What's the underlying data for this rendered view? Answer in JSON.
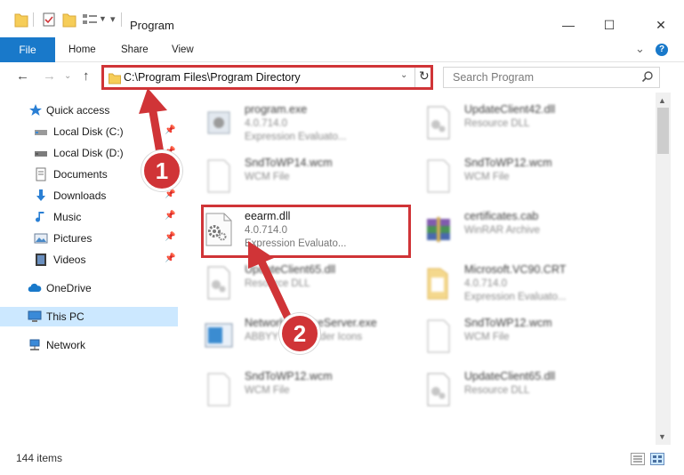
{
  "window": {
    "title": "Program",
    "controls": {
      "minimize": "—",
      "maximize": "☐",
      "close": "✕"
    }
  },
  "ribbon": {
    "tabs": [
      {
        "label": "File"
      },
      {
        "label": "Home"
      },
      {
        "label": "Share"
      },
      {
        "label": "View"
      }
    ],
    "expand_glyph": "⌄",
    "help_glyph": "?"
  },
  "nav": {
    "back": "←",
    "forward": "→",
    "history": "⌄",
    "up": "↑"
  },
  "address": {
    "path": "C:\\Program Files\\Program Directory",
    "dropdown": "⌄",
    "refresh": "↻"
  },
  "search": {
    "placeholder": "Search Program"
  },
  "sidebar": {
    "items": [
      {
        "label": "Quick access",
        "icon": "star-icon"
      },
      {
        "label": "Local Disk (C:)",
        "icon": "drive-icon",
        "pinned": true
      },
      {
        "label": "Local Disk (D:)",
        "icon": "drive-icon",
        "pinned": true
      },
      {
        "label": "Documents",
        "icon": "documents-icon",
        "pinned": true
      },
      {
        "label": "Downloads",
        "icon": "download-icon",
        "pinned": true
      },
      {
        "label": "Music",
        "icon": "music-icon",
        "pinned": true
      },
      {
        "label": "Pictures",
        "icon": "pictures-icon",
        "pinned": true
      },
      {
        "label": "Videos",
        "icon": "videos-icon",
        "pinned": true
      },
      {
        "label": "OneDrive",
        "icon": "cloud-icon"
      },
      {
        "label": "This PC",
        "icon": "computer-icon",
        "selected": true
      },
      {
        "label": "Network",
        "icon": "network-icon"
      }
    ],
    "pin_glyph": "📌"
  },
  "files": [
    {
      "name": "program.exe",
      "line1": "4.0.714.0",
      "line2": "Expression Evaluato...",
      "icon": "exe-icon"
    },
    {
      "name": "UpdateClient42.dll",
      "line1": "Resource DLL",
      "line2": "",
      "icon": "dll-icon"
    },
    {
      "name": "SndToWP14.wcm",
      "line1": "WCM File",
      "line2": "",
      "icon": "blank-file-icon"
    },
    {
      "name": "SndToWP12.wcm",
      "line1": "WCM File",
      "line2": "",
      "icon": "blank-file-icon"
    },
    {
      "name": "eearm.dll",
      "line1": "4.0.714.0",
      "line2": "Expression Evaluato...",
      "icon": "dll-gear-icon"
    },
    {
      "name": "certificates.cab",
      "line1": "WinRAR Archive",
      "line2": "",
      "icon": "winrar-icon"
    },
    {
      "name": "UpdateClient65.dll",
      "line1": "Resource DLL",
      "line2": "",
      "icon": "dll-icon"
    },
    {
      "name": "Microsoft.VC90.CRT",
      "line1": "4.0.714.0",
      "line2": "Expression Evaluato...",
      "icon": "folder-icon"
    },
    {
      "name": "NetworkLicenseServer.exe",
      "line1": "ABBYY FineReader Icons",
      "line2": "",
      "icon": "app-window-icon"
    },
    {
      "name": "SndToWP12.wcm",
      "line1": "WCM File",
      "line2": "",
      "icon": "blank-file-icon"
    },
    {
      "name": "SndToWP12.wcm",
      "line1": "WCM File",
      "line2": "",
      "icon": "blank-file-icon"
    },
    {
      "name": "UpdateClient65.dll",
      "line1": "Resource DLL",
      "line2": "",
      "icon": "dll-icon"
    }
  ],
  "status": {
    "count_text": "144 items"
  },
  "annotations": [
    {
      "number": "1"
    },
    {
      "number": "2"
    }
  ],
  "colors": {
    "accent": "#1979ca",
    "highlight": "#d03437",
    "selection": "#cce8ff"
  }
}
